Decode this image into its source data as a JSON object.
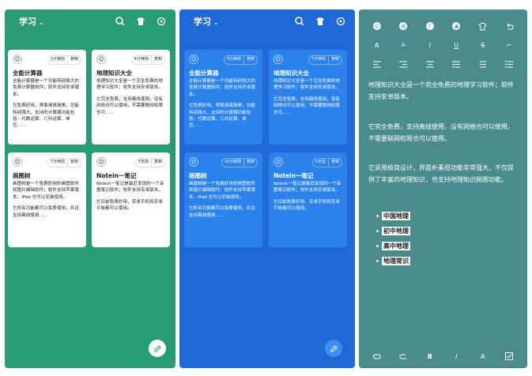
{
  "colors": {
    "panel1_bg": "#2a9c73",
    "panel2_bg": "#1f68d6",
    "panel3_bg": "#4a8c8c",
    "card1_bg": "#ffffff",
    "card2_bg": "#2b82ea",
    "text_dark": "#222222",
    "text_light": "#ffffff"
  },
  "header": {
    "title": "学习"
  },
  "cards": [
    {
      "avatar": "☺",
      "badge_time": "2分钟前",
      "badge_action": "复制",
      "title": "全能计算器",
      "p1": "全能计算器是一个功能特别强大的免费计算器软件；软件支持安卓版本。",
      "p2": "它免费好用，界面清爽简美，功能特别强大，支持的计算器功能包括：代数运算、几何运算、单位……"
    },
    {
      "avatar": "☺",
      "badge_time": "4分钟前",
      "badge_action": "复制",
      "title": "地理知识大全",
      "p1": "地理知识大全是一个完全免费的地理学习软件；软件支持安卓版本。",
      "p2": "它完全免费，支持离线使用，没有网络也可以使用，不需要联网权限也可……"
    },
    {
      "avatar": "☺",
      "badge_time": "7分钟前",
      "badge_action": "复制",
      "title": "画图树",
      "p1": "画图树是一个免费好用的画图软件和图片编辑软件；软件支持苹果版本，iPad 也可以安装使用。",
      "p2": "它所有功能都可以免费使用，并且支持离线使用……"
    },
    {
      "avatar": "☺",
      "badge_time": "5天前",
      "badge_action": "复制",
      "title": "Notein一笔记",
      "p1": "Notein一笔记是最近发现的一个采震笔记软件；软件支持安卓版本。",
      "p2": "它目前免费好用，安卓手机和安卓平板都可以使用。"
    }
  ],
  "cards_blue": [
    {
      "badge_time": "3分钟前",
      "badge_action": "复制"
    },
    {
      "badge_time": "7分钟前",
      "badge_action": "复制"
    },
    {
      "badge_time": "10分钟前",
      "badge_action": "复制"
    },
    {
      "badge_time": "5天前",
      "badge_action": "复制"
    }
  ],
  "editor": {
    "p1": "地理知识大全是一个完全免费的地理学习软件；软件支持安卓版本。",
    "p2": "它完全免费，支持离线使用，没有网络也可以使用，不需要联网权限也可以使用。",
    "p3": "它采用极简设计，界面朴素但功能非常强大，不仅提供了丰富的地理知识，也支持地理知识刷题功能。",
    "list": [
      "中国地理",
      "初中地理",
      "高中地理",
      "地理常识"
    ],
    "toolbar_row2": [
      "A",
      "A",
      "I",
      "U",
      "S",
      "⌐"
    ],
    "bottom_labels": [
      "B",
      "I",
      "A"
    ]
  }
}
